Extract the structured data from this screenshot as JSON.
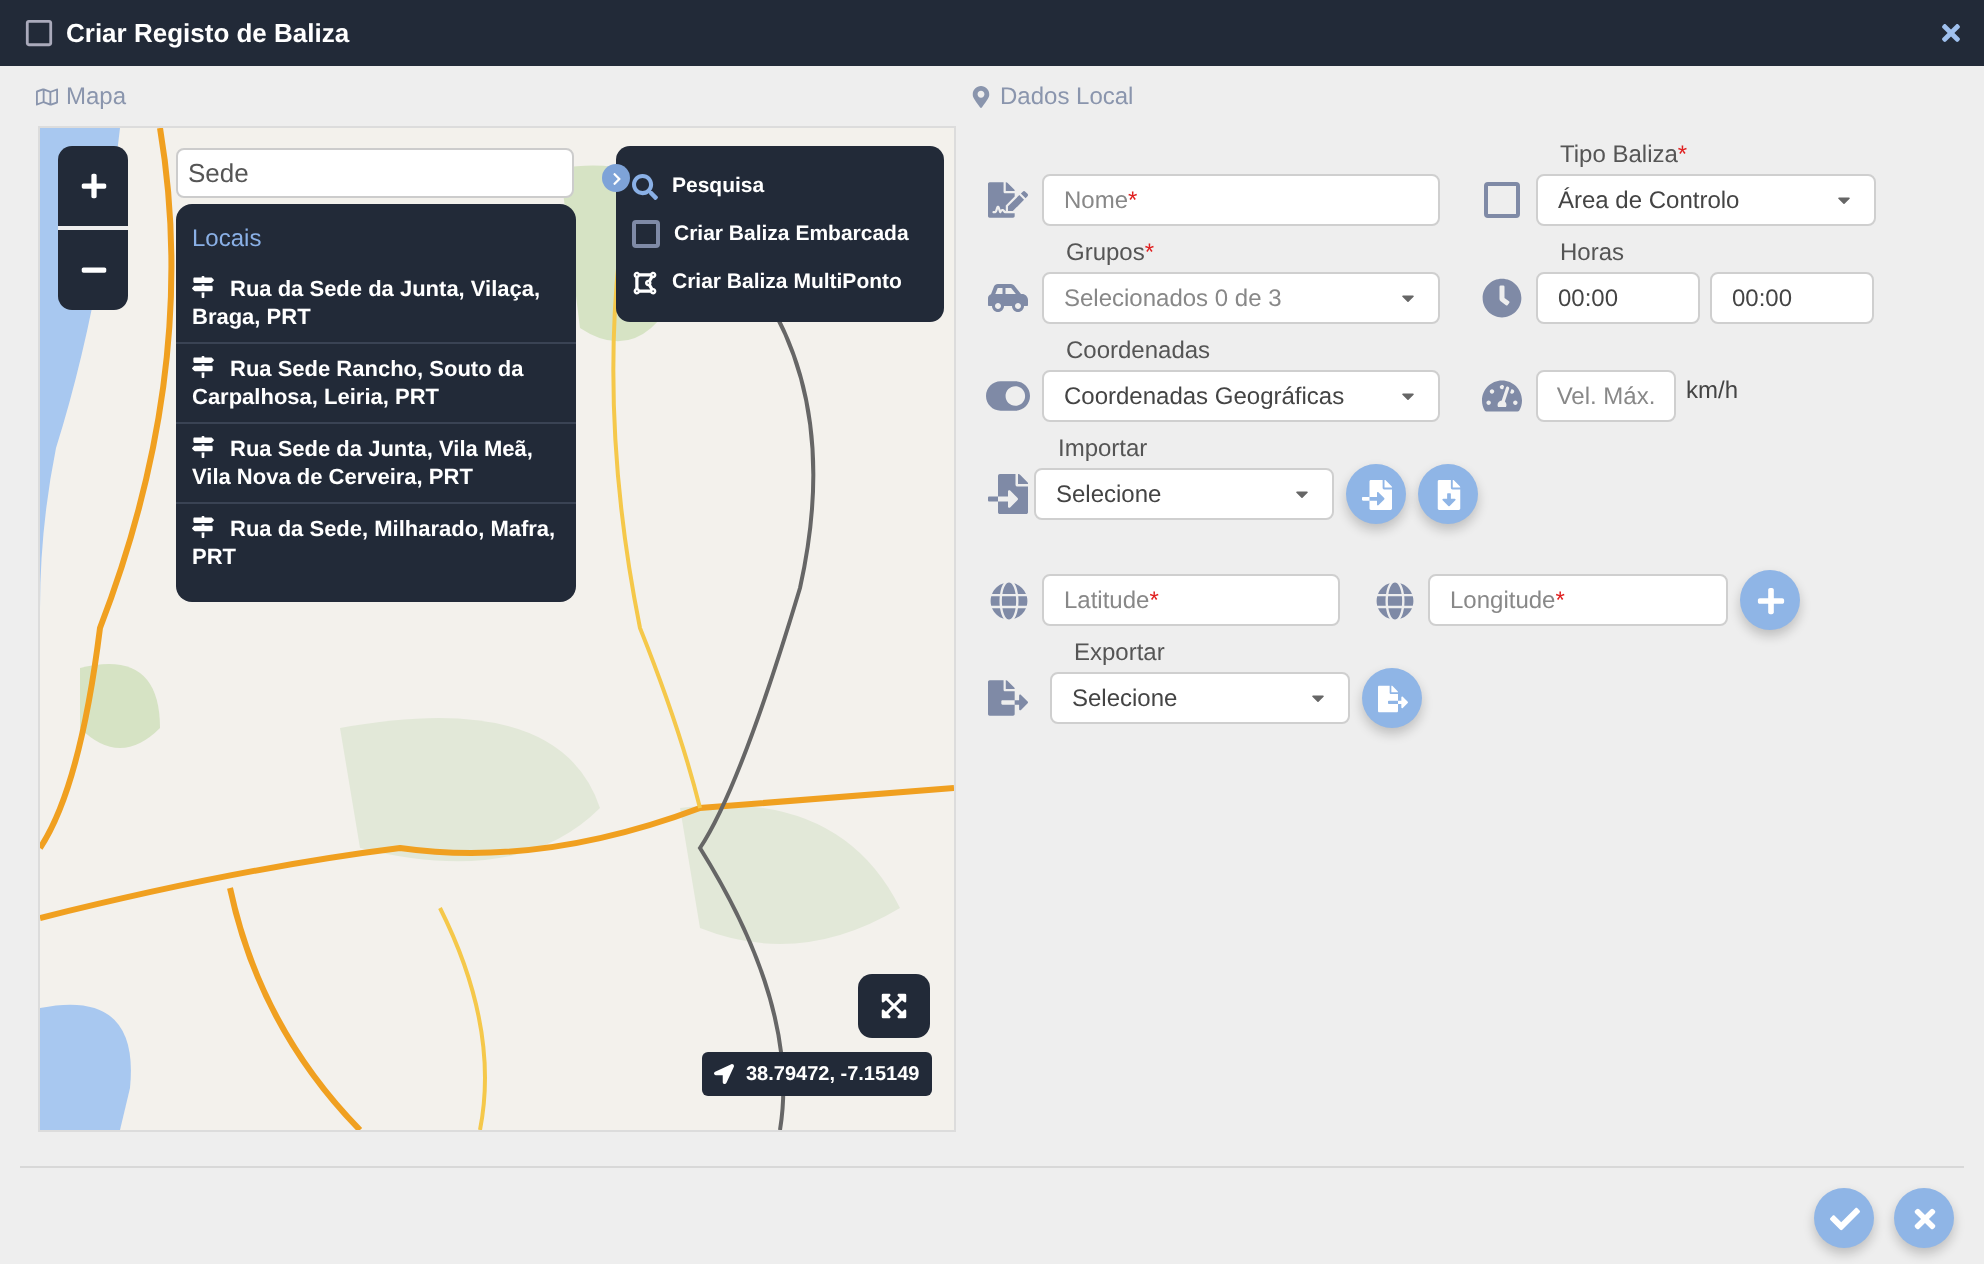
{
  "window": {
    "title": "Criar Registo de Baliza"
  },
  "map_section": {
    "title": "Mapa"
  },
  "map": {
    "search": {
      "value": "Sede"
    },
    "results": {
      "heading": "Locais",
      "items": [
        {
          "label": "Rua da Sede da Junta, Vilaça, Braga, PRT"
        },
        {
          "label": "Rua Sede Rancho, Souto da Carpalhosa, Leiria, PRT"
        },
        {
          "label": "Rua Sede da Junta, Vila Meã, Vila Nova de Cerveira, PRT"
        },
        {
          "label": "Rua da Sede, Milharado, Mafra, PRT"
        }
      ]
    },
    "menu": [
      {
        "kind": "search",
        "label": "Pesquisa"
      },
      {
        "kind": "checkbox",
        "label": "Criar Baliza Embarcada",
        "checked": false
      },
      {
        "kind": "polygon",
        "label": "Criar Baliza MultiPonto"
      }
    ],
    "coordinates": "38.79472, -7.15149"
  },
  "form": {
    "title": "Dados Local",
    "name": {
      "placeholder": "Nome",
      "required_mark": "*"
    },
    "type": {
      "label": "Tipo Baliza",
      "required_mark": "*",
      "value": "Área de Controlo",
      "checked": false
    },
    "groups": {
      "label": "Grupos",
      "required_mark": "*",
      "placeholder": "Selecionados 0 de 3"
    },
    "hours": {
      "label": "Horas",
      "from": "00:00",
      "to": "00:00"
    },
    "coordinates": {
      "label": "Coordenadas",
      "value": "Coordenadas Geográficas"
    },
    "speed": {
      "placeholder": "Vel. Máx.",
      "unit": "km/h"
    },
    "import": {
      "label": "Importar",
      "value": "Selecione"
    },
    "latitude": {
      "placeholder": "Latitude",
      "required_mark": "*"
    },
    "longitude": {
      "placeholder": "Longitude",
      "required_mark": "*"
    },
    "export": {
      "label": "Exportar",
      "value": "Selecione"
    }
  }
}
